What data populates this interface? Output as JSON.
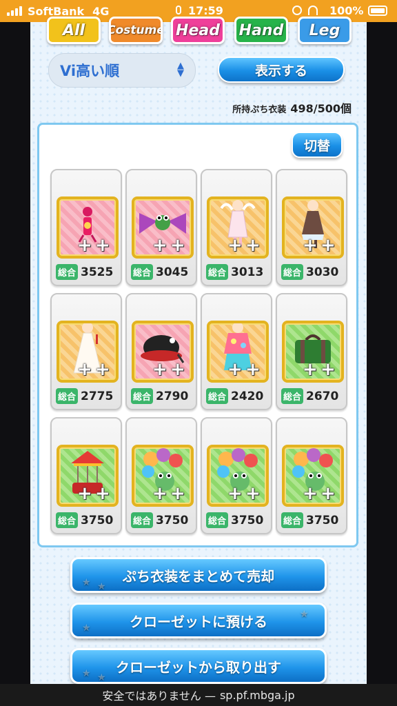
{
  "status_bar": {
    "carrier": "SoftBank",
    "network": "4G",
    "time": "17:59",
    "battery": "100%"
  },
  "tabs": [
    {
      "label": "All",
      "color": "#f2c21b"
    },
    {
      "label": "Costume",
      "color": "#f08a2a"
    },
    {
      "label": "Head",
      "color": "#ef3f9a"
    },
    {
      "label": "Hand",
      "color": "#27b34a"
    },
    {
      "label": "Leg",
      "color": "#3a9be8"
    }
  ],
  "sort": {
    "value": "Vi高い順"
  },
  "display_button": "表示する",
  "owned": {
    "label": "所持ぷち衣装",
    "count": "498/500個"
  },
  "switch_button": "切替",
  "score_label": "総合",
  "items": [
    {
      "score": "3525",
      "bg": "pink",
      "icon": "ribbon-ornament"
    },
    {
      "score": "3045",
      "bg": "pink",
      "icon": "frog-bow"
    },
    {
      "score": "3013",
      "bg": "orange",
      "icon": "white-dress"
    },
    {
      "score": "3030",
      "bg": "orange",
      "icon": "brown-dress"
    },
    {
      "score": "2775",
      "bg": "orange",
      "icon": "wedding-dress"
    },
    {
      "score": "2790",
      "bg": "pink",
      "icon": "black-hat"
    },
    {
      "score": "2420",
      "bg": "orange",
      "icon": "kimono"
    },
    {
      "score": "2670",
      "bg": "green",
      "icon": "green-bag"
    },
    {
      "score": "3750",
      "bg": "green",
      "icon": "carousel"
    },
    {
      "score": "3750",
      "bg": "green",
      "icon": "frog-balloons"
    },
    {
      "score": "3750",
      "bg": "green",
      "icon": "frog-balloons"
    },
    {
      "score": "3750",
      "bg": "green",
      "icon": "frog-balloons"
    }
  ],
  "actions": {
    "sell": "ぷち衣装をまとめて売却",
    "deposit": "クローゼットに預ける",
    "withdraw": "クローゼットから取り出す"
  },
  "url_bar": {
    "security": "安全ではありません —",
    "domain": "sp.pf.mbga.jp"
  }
}
